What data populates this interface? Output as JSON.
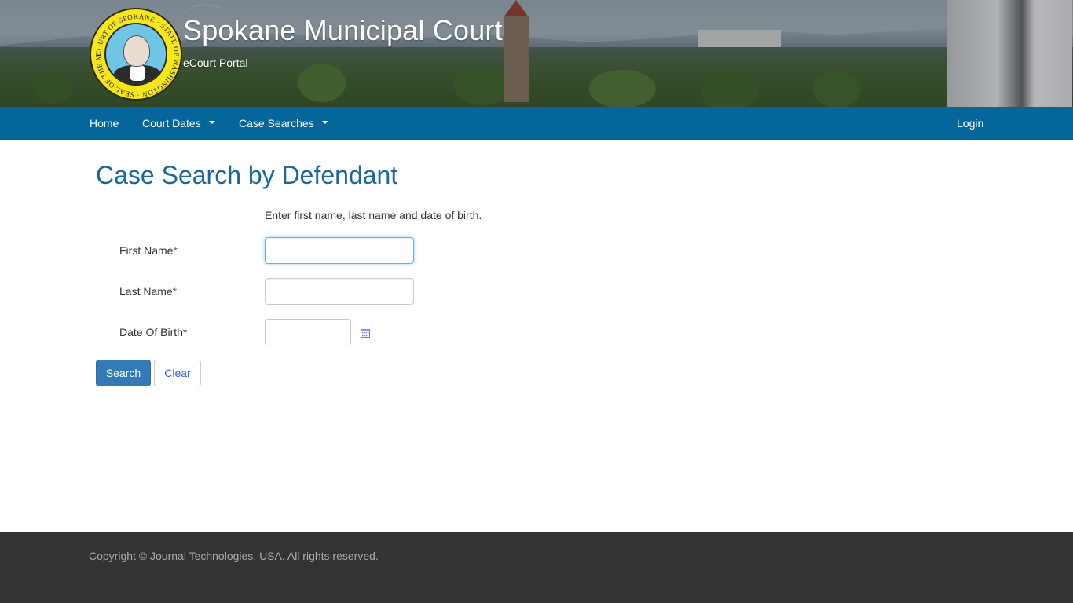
{
  "header": {
    "title": "Spokane Municipal Court",
    "subtitle": "eCourt Portal",
    "seal_alt": "Seal of the Municipal Court of Spokane, State of Washington"
  },
  "nav": {
    "items": [
      {
        "label": "Home",
        "has_dropdown": false
      },
      {
        "label": "Court Dates",
        "has_dropdown": true
      },
      {
        "label": "Case Searches",
        "has_dropdown": true
      }
    ],
    "login_label": "Login"
  },
  "main": {
    "title": "Case Search by Defendant",
    "instructions": "Enter first name, last name and date of birth.",
    "fields": [
      {
        "label": "First Name",
        "required_marker": "*",
        "value": "",
        "placeholder": ""
      },
      {
        "label": "Last Name",
        "required_marker": "*",
        "value": "",
        "placeholder": ""
      },
      {
        "label": "Date Of Birth",
        "required_marker": "*",
        "value": "",
        "placeholder": ""
      }
    ],
    "calendar_icon": "calendar-icon",
    "search_label": "Search",
    "clear_label": "Clear"
  },
  "footer": {
    "copyright": "Copyright © Journal Technologies, USA. All rights reserved."
  },
  "colors": {
    "nav_bg": "#04669a",
    "title": "#19679b",
    "primary_button": "#337ab7",
    "footer_bg": "#333333",
    "required": "#a94442"
  }
}
